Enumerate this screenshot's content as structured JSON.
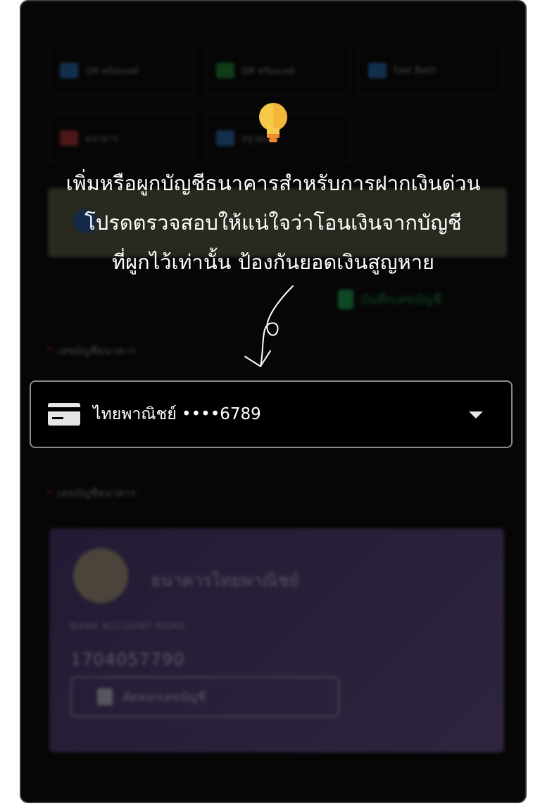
{
  "payment_methods": [
    {
      "label": "QR พร้อมเพย์",
      "color": "#2f7fd6"
    },
    {
      "label": "QR พร้อมเพย์",
      "color": "#22a83a"
    },
    {
      "label": "Fast Bath",
      "color": "#2f7fd6"
    },
    {
      "label": "ธนาคาร",
      "color": "#d23a3a"
    },
    {
      "label": "ทรูวอเลต",
      "color": "#2f7fd6"
    }
  ],
  "add_bank_link": "บันทึกเลขบัญชี",
  "field_label_deposit": "เลขบัญชีธนาคาร",
  "field_label_bank": "เลขบัญชีธนาคาร",
  "bank_card": {
    "bank_name": "ธนาคารไทยพาณิชย์",
    "account_name": "BANK ACCOUNT NAME",
    "account_number": "1704057790",
    "copy_button": "คัดลอกเลขบัญชี"
  },
  "tip": {
    "line1": "เพิ่มหรือผูกบัญชีธนาคารสำหรับการฝากเงินด่วน",
    "line2": "โปรดตรวจสอบให้แน่ใจว่าโอนเงินจากบัญชี",
    "line3": "ที่ผูกไว้เท่านั้น ป้องกันยอดเงินสูญหาย"
  },
  "account_select": {
    "value": "ไทยพาณิชย์ ••••6789"
  },
  "colors": {
    "accent_green": "#22c55e",
    "card_purple": "#6b4c98",
    "bulb_yellow": "#f7c948"
  }
}
